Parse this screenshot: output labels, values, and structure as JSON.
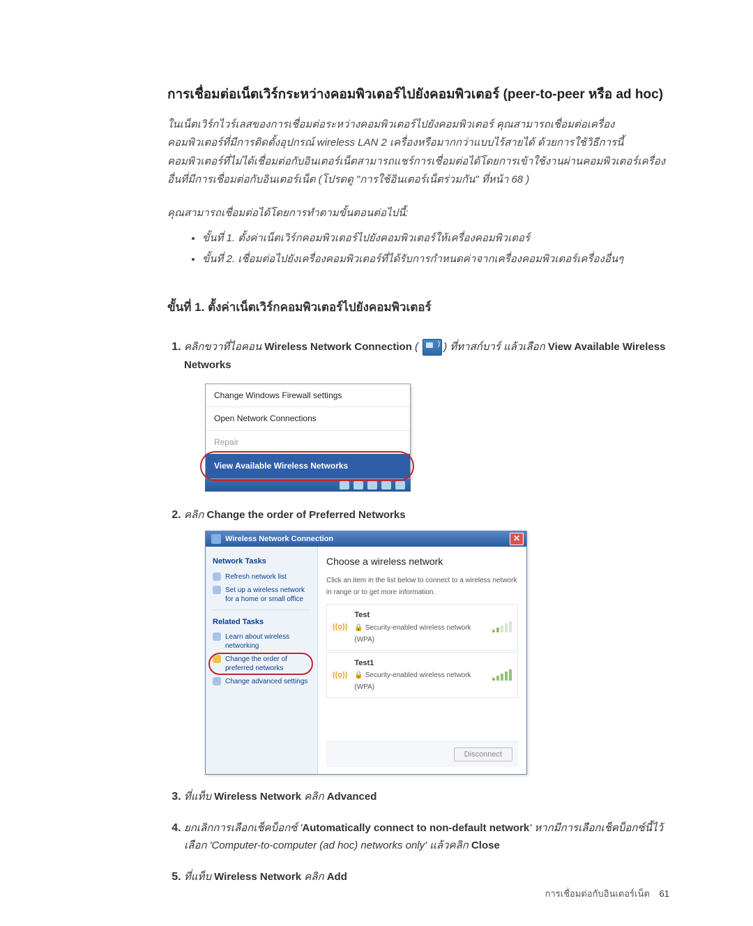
{
  "heading": "การเชื่อมต่อเน็ตเวิร์กระหว่างคอมพิวเตอร์ไปยังคอมพิวเตอร์ (peer-to-peer หรือ ad hoc)",
  "intro": "ในเน็ตเวิร์กไวร์เลสของการเชื่อมต่อระหว่างคอมพิวเตอร์ไปยังคอมพิวเตอร์ คุณสามารถเชื่อมต่อเครื่องคอมพิวเตอร์ที่มีการติดตั้งอุปกรณ์ wireless LAN 2 เครื่องหรือมากกว่าแบบไร้สายได้ ด้วยการใช้วิธีการนี้ คอมพิวเตอร์ที่ไม่ได้เชื่อมต่อกับอินเตอร์เน็ตสามารถแชร์การเชื่อมต่อได้โดยการเข้าใช้งานผ่านคอมพิวเตอร์เครื่องอื่นที่มีการเชื่อมต่อกับอินเตอร์เน็ต (โปรดดู \"การใช้อินเตอร์เน็ตร่วมกัน\" ที่หน้า 68 )",
  "lead": "คุณสามารถเชื่อมต่อได้โดยการทำตามขั้นตอนต่อไปนี้:",
  "bullets": [
    "ขั้นที่ 1. ตั้งค่าเน็ตเวิร์กคอมพิวเตอร์ไปยังคอมพิวเตอร์ให้เครื่องคอมพิวเตอร์",
    "ขั้นที่ 2. เชื่อมต่อไปยังเครื่องคอมพิวเตอร์ที่ได้รับการกำหนดค่าจากเครื่องคอมพิวเตอร์เครื่องอื่นๆ"
  ],
  "step_title": "ขั้นที่ 1. ตั้งค่าเน็ตเวิร์กคอมพิวเตอร์ไปยังคอมพิวเตอร์",
  "steps": {
    "s1": {
      "a": "คลิกขวาที่ไอคอน ",
      "b": "Wireless Network Connection",
      "c": " ( ",
      "d": ") ที่ทาสก์บาร์ แล้วเลือก ",
      "e": "View Available Wireless Networks"
    },
    "s2": {
      "a": "คลิก ",
      "b": "Change the order of Preferred Networks"
    },
    "s3": {
      "a": "ที่แท็บ ",
      "b": "Wireless Network",
      "c": " คลิก ",
      "d": "Advanced"
    },
    "s4": {
      "a": "ยกเลิกการเลือกเช็คบ็อกซ์ '",
      "b": "Automatically connect to non-default network",
      "c": "' หากมีการเลือกเช็คบ็อกซ์นี้ไว้ เลือก '",
      "d": "Computer-to-computer (ad hoc) networks only",
      "e": "' แล้วคลิก ",
      "f": "Close"
    },
    "s5": {
      "a": "ที่แท็บ ",
      "b": "Wireless Network",
      "c": " คลิก ",
      "d": "Add"
    }
  },
  "ctx_menu": {
    "items": [
      "Change Windows Firewall settings",
      "Open Network Connections",
      "Repair"
    ],
    "highlight": "View Available Wireless Networks"
  },
  "dlg": {
    "title": "Wireless Network Connection",
    "left": {
      "head1": "Network Tasks",
      "link_refresh": "Refresh network list",
      "link_setup": "Set up a wireless network for a home or small office",
      "head2": "Related Tasks",
      "link_learn": "Learn about wireless networking",
      "link_order": "Change the order of preferred networks",
      "link_adv": "Change advanced settings"
    },
    "right": {
      "heading": "Choose a wireless network",
      "hint": "Click an item in the list below to connect to a wireless network in range or to get more information.",
      "nets": [
        {
          "name": "Test",
          "sec": "Security-enabled wireless network (WPA)"
        },
        {
          "name": "Test1",
          "sec": "Security-enabled wireless network (WPA)"
        }
      ],
      "disconnect": "Disconnect"
    }
  },
  "footer": {
    "label": "การเชื่อมต่อกับอินเตอร์เน็ต",
    "page": "61"
  }
}
